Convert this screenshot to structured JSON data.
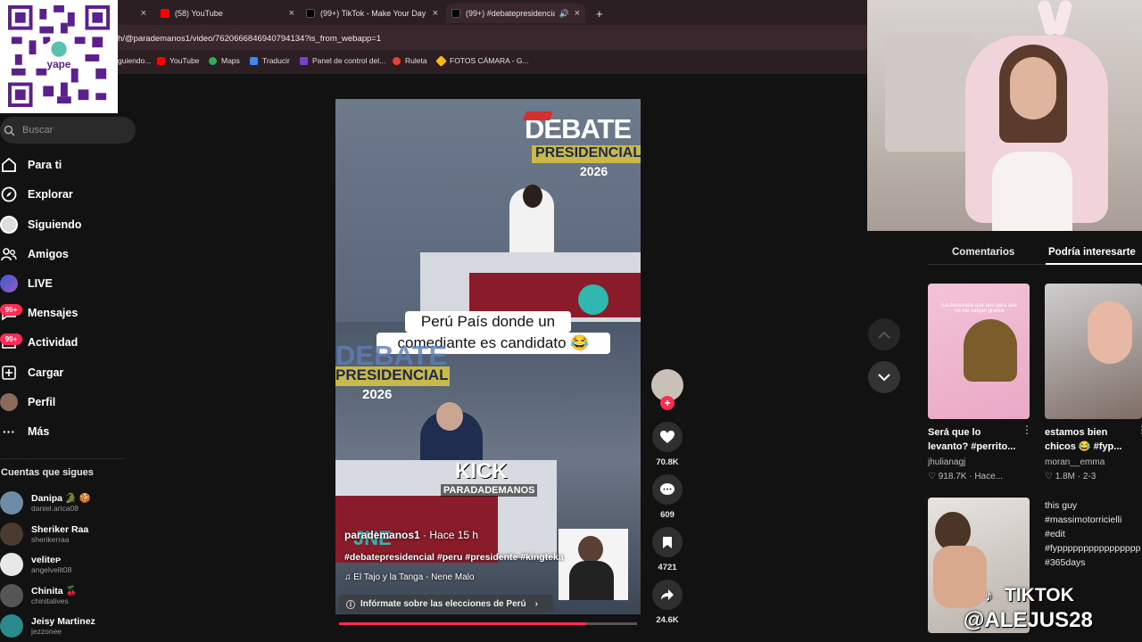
{
  "browser": {
    "tabs": [
      {
        "label": "",
        "close": "×"
      },
      {
        "label": "(58) YouTube",
        "close": "×"
      },
      {
        "label": "(99+) TikTok - Make Your Day",
        "close": "×"
      },
      {
        "label": "(99+) #debatepresidencial",
        "close": "×"
      }
    ],
    "new_tab": "+",
    "url": "h/@parademanos1/video/7620666846940794134?is_from_webapp=1",
    "bookmarks": [
      "guiendo...",
      "YouTube",
      "Maps",
      "Traducir",
      "Panel de control del...",
      "Ruleta",
      "FOTOS CÁMARA - G..."
    ]
  },
  "qr": {
    "brand": "yape"
  },
  "sidebar": {
    "search_placeholder": "Buscar",
    "nav": [
      {
        "label": "Para ti",
        "icon": "home-icon"
      },
      {
        "label": "Explorar",
        "icon": "compass-icon"
      },
      {
        "label": "Siguiendo",
        "icon": "following-avatar-icon"
      },
      {
        "label": "Amigos",
        "icon": "friends-icon"
      },
      {
        "label": "LIVE",
        "icon": "live-icon"
      },
      {
        "label": "Mensajes",
        "icon": "messages-icon",
        "badge": "99+"
      },
      {
        "label": "Actividad",
        "icon": "activity-icon",
        "badge": "99+"
      },
      {
        "label": "Cargar",
        "icon": "upload-icon"
      },
      {
        "label": "Perfil",
        "icon": "profile-avatar-icon"
      },
      {
        "label": "Más",
        "icon": "more-icon"
      }
    ],
    "following_title": "Cuentas que sigues",
    "following": [
      {
        "name": "Danipa 🐊 🍪",
        "user": "daniel.arica08"
      },
      {
        "name": "Sheriker Raa",
        "user": "sherikerraa"
      },
      {
        "name": "veliteᴘ",
        "user": "angelvelit08"
      },
      {
        "name": "Chinita 🍒",
        "user": "chinitalives"
      },
      {
        "name": "Jeisy Martinez",
        "user": "jezzonee"
      }
    ]
  },
  "video": {
    "debate_top": "DEBATE",
    "presidencial_top": "PRESIDENCIAL",
    "year_top": "2026",
    "caption_line1": "Perú País donde un",
    "caption_line2": "comediante es candidato 😂",
    "debate_mid": "DEBATE",
    "presidencial_mid": "PRESIDENCIAL",
    "year_mid": "2026",
    "kick": "KICK",
    "watermark": "PARADADEMANOS",
    "jne": "JNE",
    "author": "parademanos1",
    "time": "· Hace 15 h",
    "hashtags": "#debatepresidencial #peru #presidente #kingteka",
    "music": "El Tajo y la Tanga - Nene Malo",
    "info": "Infórmate sobre las elecciones de Perú",
    "progress": 0.83
  },
  "actions": {
    "likes": "70.8K",
    "comments": "609",
    "saves": "4721",
    "shares": "24.6K"
  },
  "panel": {
    "tab_comments": "Comentarios",
    "tab_interest": "Podría interesarte",
    "items": [
      {
        "thumb_text": "La demorada que uno para que no me salgan granos",
        "title_l1": "Será que lo",
        "title_l2": "levanto? #perrito...",
        "author": "jhulianagj",
        "stats": "♡ 918.7K · Hace..."
      },
      {
        "thumb_text": "",
        "title_l1": "estamos bien",
        "title_l2": "chicos 😂 #fyp...",
        "author": "moran__emma",
        "stats": "♡ 1.8M · 2-3"
      },
      {
        "thumb_text": "",
        "title_l1": "",
        "title_l2": "",
        "author": "",
        "stats": ""
      },
      {
        "thumb_text": "",
        "alt_l1": "this guy",
        "alt_l2": "#massimotorricielli",
        "alt_l3": "#edit",
        "alt_l4": "#fypppppppppppppppp",
        "alt_l5": "#365days"
      }
    ]
  },
  "overlay": {
    "line1": "TIKTOK",
    "line2": "@ALEJUS28"
  },
  "colors": {
    "accent": "#fe2c55",
    "bg": "#121212",
    "tab_bar": "#2b1f24"
  }
}
